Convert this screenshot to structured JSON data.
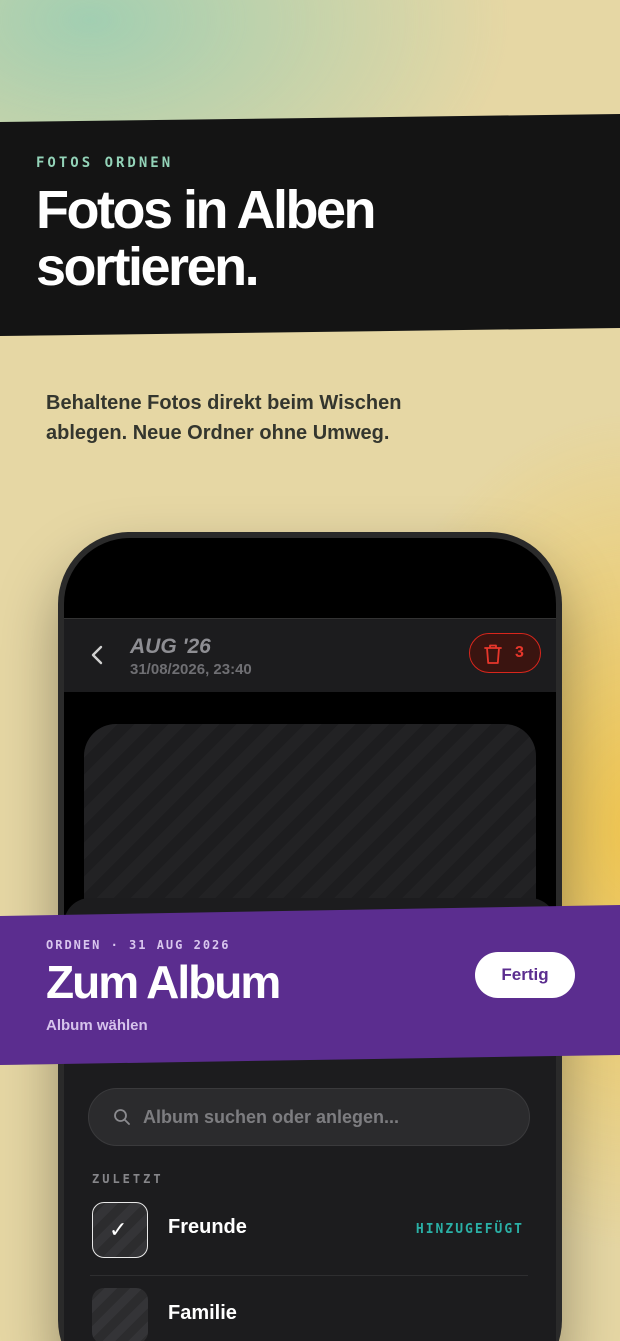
{
  "intro": {
    "eyebrow": "FOTOS ORDNEN",
    "headline": "Fotos in Alben sortieren.",
    "subtext": "Behaltene Fotos direkt beim Wischen ablegen. Neue Ordner ohne Umweg."
  },
  "app_header": {
    "title": "AUG '26",
    "timestamp": "31/08/2026, 23:40",
    "trash_count": "3",
    "back_icon": "chevron-left-icon",
    "trash_icon": "trash-icon"
  },
  "sheet_header": {
    "eyebrow": "ORDNEN · 31 AUG 2026",
    "title": "Zum Album",
    "subtitle": "Album wählen",
    "done_label": "Fertig"
  },
  "search": {
    "placeholder": "Album suchen oder anlegen...",
    "value": "",
    "icon": "search-icon"
  },
  "recent": {
    "label": "ZULETZT",
    "albums": [
      {
        "name": "Freunde",
        "status": "HINZUGEFÜGT",
        "selected": true
      },
      {
        "name": "Familie",
        "status": "",
        "selected": false
      }
    ]
  },
  "colors": {
    "accent_purple": "#5b2d8f",
    "accent_mint": "#93d3b8",
    "danger_red": "#e8362b",
    "status_teal": "#2ab0a6",
    "banner_dark": "#141414"
  }
}
